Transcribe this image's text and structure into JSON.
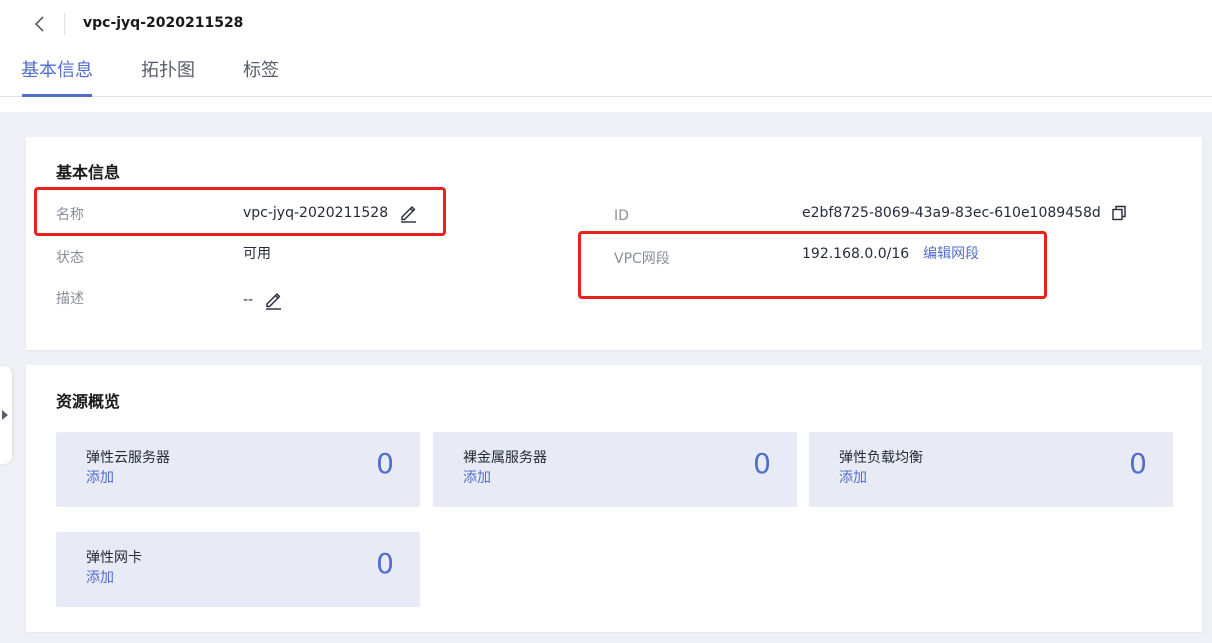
{
  "header": {
    "title": "vpc-jyq-2020211528"
  },
  "tabs": [
    {
      "label": "基本信息",
      "active": true
    },
    {
      "label": "拓扑图",
      "active": false
    },
    {
      "label": "标签",
      "active": false
    }
  ],
  "basic_info": {
    "title": "基本信息",
    "name_label": "名称",
    "name_value": "vpc-jyq-2020211528",
    "status_label": "状态",
    "status_value": "可用",
    "desc_label": "描述",
    "desc_value": "--",
    "id_label": "ID",
    "id_value": "e2bf8725-8069-43a9-83ec-610e1089458d",
    "cidr_label": "VPC网段",
    "cidr_value": "192.168.0.0/16",
    "cidr_edit_link": "编辑网段"
  },
  "resources": {
    "title": "资源概览",
    "items": [
      {
        "name": "弹性云服务器",
        "add_label": "添加",
        "count": "0"
      },
      {
        "name": "裸金属服务器",
        "add_label": "添加",
        "count": "0"
      },
      {
        "name": "弹性负载均衡",
        "add_label": "添加",
        "count": "0"
      },
      {
        "name": "弹性网卡",
        "add_label": "添加",
        "count": "0"
      }
    ]
  },
  "colors": {
    "accent": "#526ecc",
    "highlight_box": "#e8211f",
    "tile_bg": "#e8ebf6",
    "page_bg": "#eef0f5"
  },
  "icons": {
    "back": "chevron-left-icon",
    "edit": "pencil-icon",
    "copy": "copy-icon",
    "expand": "caret-right-icon"
  }
}
